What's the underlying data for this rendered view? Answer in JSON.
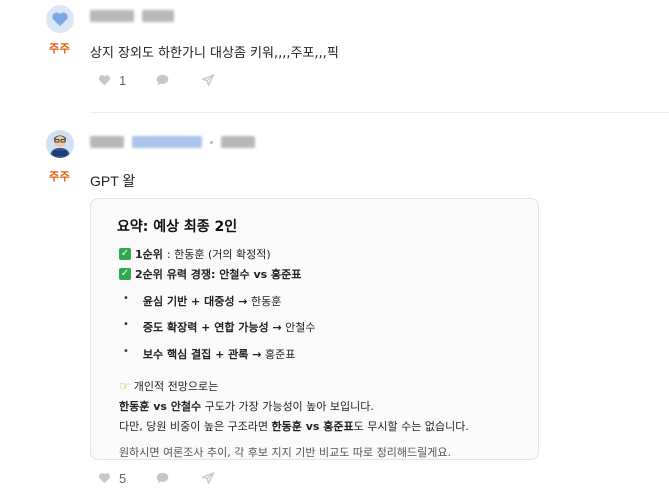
{
  "comments": [
    {
      "badge": "주주",
      "text": "상지 장외도 하한가니 대상좀 키워,,,,주포,,,픽",
      "likes": "1"
    },
    {
      "badge": "주주",
      "text": "GPT 왈",
      "likes": "5",
      "card": {
        "title": "요약: 예상 최종 2인",
        "check1_label": "1순위",
        "check1_rest": ": 한동훈 (거의 확정적)",
        "check2_label": "2순위 유력 경쟁: 안철수 vs 홍준표",
        "bullets": [
          {
            "bold": "윤심 기반 + 대중성 →",
            "rest": " 한동훈"
          },
          {
            "bold": "중도 확장력 + 연합 가능성 →",
            "rest": " 안철수"
          },
          {
            "bold": "보수 핵심 결집 + 관록 →",
            "rest": " 홍준표"
          }
        ],
        "outlook_label": "개인적 전망으로는",
        "outlook_line1_bold": "한동훈 vs 안철수",
        "outlook_line1_rest": " 구도가 가장 가능성이 높아 보입니다.",
        "outlook_line2_pre": "다만, 당원 비중이 높은 구조라면 ",
        "outlook_line2_bold": "한동훈 vs 홍준표",
        "outlook_line2_rest": "도 무시할 수는 없습니다.",
        "footer": "원하시면 여론조사 추이, 각 후보 지지 기반 비교도 따로 정리해드릴게요."
      }
    }
  ],
  "colors": {
    "badge": "#e8590c",
    "check": "#2fa84f",
    "link": "#a9c3ea"
  },
  "icons": [
    "heart-icon",
    "comment-icon",
    "share-icon",
    "heart-avatar-icon",
    "hand-point-icon",
    "check-icon"
  ]
}
